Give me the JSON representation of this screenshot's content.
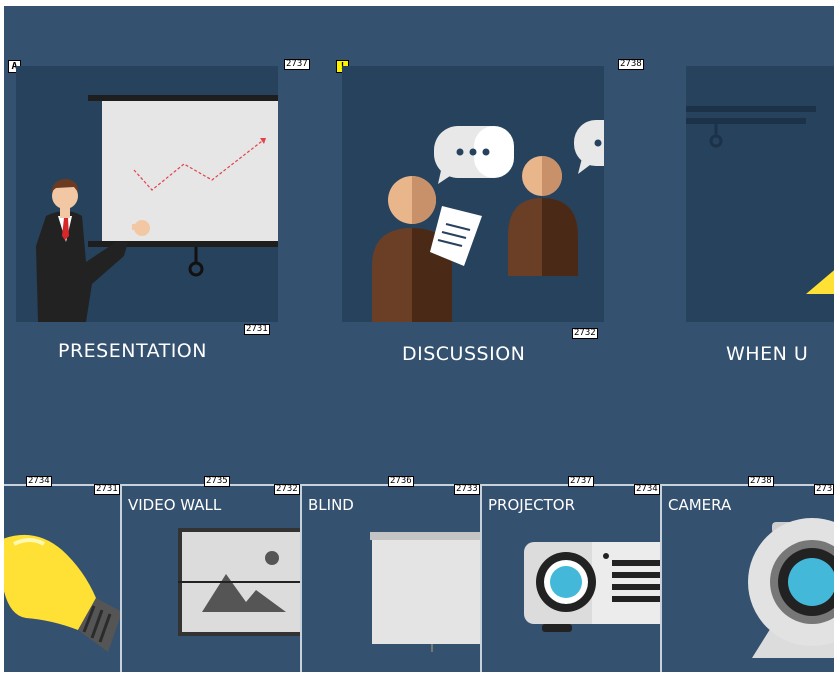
{
  "scenes": [
    {
      "label": "PRESENTATION",
      "id_top": "2737",
      "id_bottom": "2731",
      "badge": "A"
    },
    {
      "label": "DISCUSSION",
      "id_top": "2738",
      "id_bottom": "2732",
      "badge": "!"
    },
    {
      "label": "WHEN U"
    }
  ],
  "devices": [
    {
      "label": "",
      "id_top": "2734",
      "id_right": "2731"
    },
    {
      "label": "VIDEO WALL",
      "id_top": "2735",
      "id_right": "2732"
    },
    {
      "label": "BLIND",
      "id_top": "2736",
      "id_right": "2733"
    },
    {
      "label": "PROJECTOR",
      "id_top": "2737",
      "id_right": "2734"
    },
    {
      "label": "CAMERA",
      "id_top": "2738",
      "id_right": "273"
    }
  ],
  "colors": {
    "panel": "#34516f",
    "scene_bg": "#26425d",
    "bulb": "#ffe135",
    "lens": "#44b8d8"
  }
}
